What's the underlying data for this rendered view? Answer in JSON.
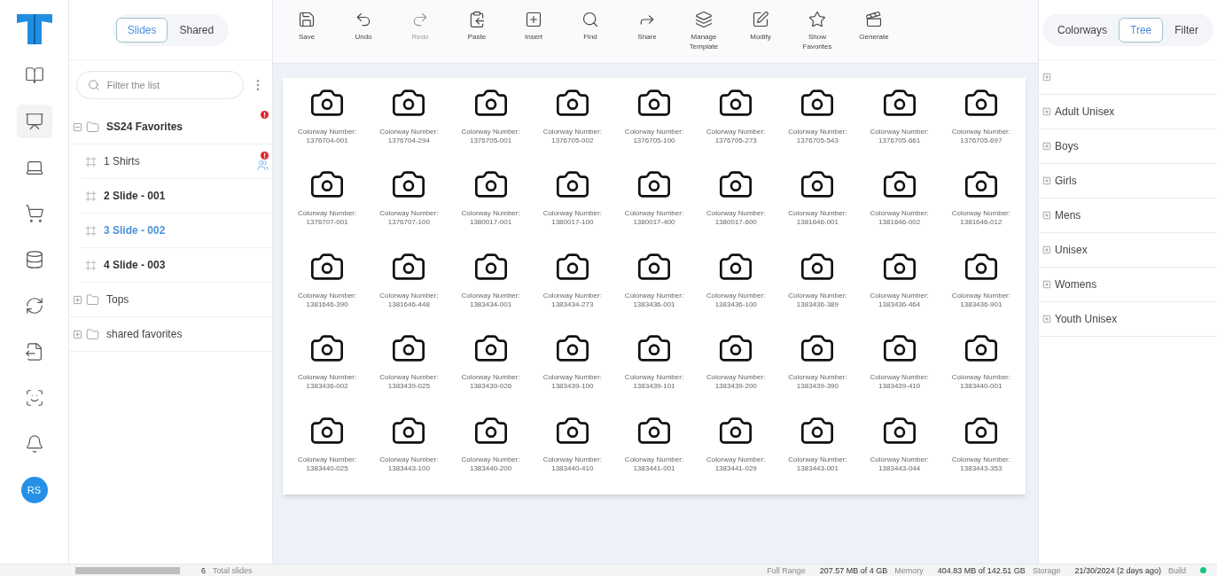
{
  "left_panel": {
    "tabs": [
      {
        "label": "Slides",
        "selected": true
      },
      {
        "label": "Shared",
        "selected": false
      }
    ],
    "search": {
      "placeholder": "Filter the list"
    },
    "tree": [
      {
        "label": "SS24 Favorites",
        "expanded": true,
        "alert": true,
        "children": [
          {
            "label": "1 Shirts",
            "selected": false,
            "alert": true,
            "shared": true
          },
          {
            "label": "2 Slide - 001",
            "selected": false,
            "alert": false,
            "shared": false
          },
          {
            "label": "3 Slide - 002",
            "selected": true,
            "alert": false,
            "shared": false
          },
          {
            "label": "4 Slide - 003",
            "selected": false,
            "alert": false,
            "shared": false
          }
        ]
      },
      {
        "label": "Tops",
        "expanded": false,
        "alert": false
      },
      {
        "label": "shared favorites",
        "expanded": false,
        "alert": false
      }
    ]
  },
  "toolbar": [
    {
      "label": "Save",
      "disabled": false
    },
    {
      "label": "Undo",
      "disabled": false
    },
    {
      "label": "Redo",
      "disabled": true
    },
    {
      "label": "Paste",
      "disabled": false
    },
    {
      "label": "Insert",
      "disabled": false
    },
    {
      "label": "Find",
      "disabled": false
    },
    {
      "label": "Share",
      "disabled": false
    },
    {
      "label": "Manage Template",
      "disabled": false
    },
    {
      "label": "Modify",
      "disabled": false
    },
    {
      "label": "Show Favorites",
      "disabled": false
    },
    {
      "label": "Generate",
      "disabled": false
    }
  ],
  "slide": {
    "tiles": [
      {
        "label": "Colorway Number:",
        "number": "1376704-001"
      },
      {
        "label": "Colorway Number:",
        "number": "1376704-294"
      },
      {
        "label": "Colorway Number:",
        "number": "1376705-001"
      },
      {
        "label": "Colorway Number:",
        "number": "1376705-002"
      },
      {
        "label": "Colorway Number:",
        "number": "1376705-100"
      },
      {
        "label": "Colorway Number:",
        "number": "1376705-273"
      },
      {
        "label": "Colorway Number:",
        "number": "1376705-543"
      },
      {
        "label": "Colorway Number:",
        "number": "1376705-661"
      },
      {
        "label": "Colorway Number:",
        "number": "1376705-697"
      },
      {
        "label": "Colorway Number:",
        "number": "1376707-001"
      },
      {
        "label": "Colorway Number:",
        "number": "1376707-100"
      },
      {
        "label": "Colorway Number:",
        "number": "1380017-001"
      },
      {
        "label": "Colorway Number:",
        "number": "1380017-100"
      },
      {
        "label": "Colorway Number:",
        "number": "1380017-400"
      },
      {
        "label": "Colorway Number:",
        "number": "1380017-600"
      },
      {
        "label": "Colorway Number:",
        "number": "1381646-001"
      },
      {
        "label": "Colorway Number:",
        "number": "1381646-002"
      },
      {
        "label": "Colorway Number:",
        "number": "1381646-012"
      },
      {
        "label": "Colorway Number:",
        "number": "1381646-390"
      },
      {
        "label": "Colorway Number:",
        "number": "1381646-448"
      },
      {
        "label": "Colorway Number:",
        "number": "1383434-001"
      },
      {
        "label": "Colorway Number:",
        "number": "1383434-273"
      },
      {
        "label": "Colorway Number:",
        "number": "1383436-001"
      },
      {
        "label": "Colorway Number:",
        "number": "1383436-100"
      },
      {
        "label": "Colorway Number:",
        "number": "1383436-389"
      },
      {
        "label": "Colorway Number:",
        "number": "1383436-464"
      },
      {
        "label": "Colorway Number:",
        "number": "1383436-901"
      },
      {
        "label": "Colorway Number:",
        "number": "1383436-002"
      },
      {
        "label": "Colorway Number:",
        "number": "1383439-025"
      },
      {
        "label": "Colorway Number:",
        "number": "1383439-026"
      },
      {
        "label": "Colorway Number:",
        "number": "1383439-100"
      },
      {
        "label": "Colorway Number:",
        "number": "1383439-101"
      },
      {
        "label": "Colorway Number:",
        "number": "1383439-200"
      },
      {
        "label": "Colorway Number:",
        "number": "1383439-390"
      },
      {
        "label": "Colorway Number:",
        "number": "1383439-410"
      },
      {
        "label": "Colorway Number:",
        "number": "1383440-001"
      },
      {
        "label": "Colorway Number:",
        "number": "1383440-025"
      },
      {
        "label": "Colorway Number:",
        "number": "1383443-100"
      },
      {
        "label": "Colorway Number:",
        "number": "1383440-200"
      },
      {
        "label": "Colorway Number:",
        "number": "1383440-410"
      },
      {
        "label": "Colorway Number:",
        "number": "1383441-001"
      },
      {
        "label": "Colorway Number:",
        "number": "1383441-029"
      },
      {
        "label": "Colorway Number:",
        "number": "1383443-001"
      },
      {
        "label": "Colorway Number:",
        "number": "1383443-044"
      },
      {
        "label": "Colorway Number:",
        "number": "1383443-353"
      }
    ]
  },
  "right_panel": {
    "tabs": [
      {
        "label": "Colorways",
        "selected": false
      },
      {
        "label": "Tree",
        "selected": true
      },
      {
        "label": "Filter",
        "selected": false
      }
    ],
    "tree": [
      {
        "expanded": false
      },
      {
        "label": "Adult Unisex",
        "expanded": false
      },
      {
        "label": "Boys",
        "expanded": false
      },
      {
        "label": "Girls",
        "expanded": false
      },
      {
        "label": "Mens",
        "expanded": false
      },
      {
        "label": "Unisex",
        "expanded": false
      },
      {
        "label": "Womens",
        "expanded": false
      },
      {
        "label": "Youth Unisex",
        "expanded": false
      }
    ]
  },
  "user": {
    "initials": "RS"
  },
  "status_bar": {
    "progress": {
      "level": 1
    },
    "slides_count": "6",
    "slides_label": "Total slides",
    "range": "Full Range",
    "memory_value": "207.57 MB of 4 GB",
    "memory_label": "Memory",
    "storage_value": "404.83 MB of 142.51 GB",
    "storage_label": "Storage",
    "build_value": "21/30/2024 (2 days ago)",
    "build_label": "Build",
    "online": true
  }
}
